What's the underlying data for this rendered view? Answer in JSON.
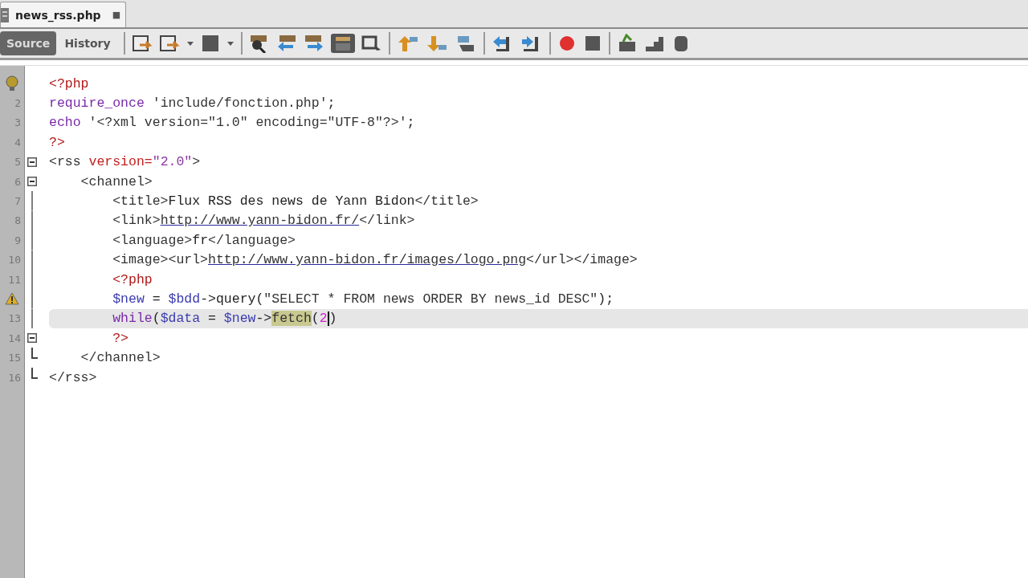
{
  "tab": {
    "title": "news_rss.php",
    "close": "■"
  },
  "toolbar": {
    "views": [
      {
        "label": "Source",
        "selected": true
      },
      {
        "label": "History",
        "selected": false
      }
    ]
  },
  "editor": {
    "lines": [
      {
        "hint": true,
        "warning": false,
        "fold_marker": false,
        "fold_end": false,
        "current": false,
        "tokens": [
          {
            "kind": "php",
            "text": "<?php"
          }
        ]
      },
      {
        "number": "2",
        "hint": false,
        "warning": false,
        "fold_marker": false,
        "fold_end": false,
        "current": false,
        "tokens": [
          {
            "kind": "keyword",
            "text": "require_once"
          },
          {
            "kind": "string",
            "text": " 'include/fonction.php'"
          },
          {
            "kind": "plain",
            "text": ";"
          }
        ]
      },
      {
        "number": "3",
        "hint": false,
        "warning": false,
        "fold_marker": false,
        "fold_end": false,
        "current": false,
        "tokens": [
          {
            "kind": "keyword",
            "text": "echo"
          },
          {
            "kind": "string",
            "text": " '<?xml version=\"1.0\" encoding=\"UTF-8\"?>'"
          },
          {
            "kind": "plain",
            "text": ";"
          }
        ]
      },
      {
        "number": "4",
        "hint": false,
        "warning": false,
        "fold_marker": false,
        "fold_end": false,
        "current": false,
        "tokens": [
          {
            "kind": "php",
            "text": "?>"
          }
        ]
      },
      {
        "number": "5",
        "hint": false,
        "warning": false,
        "fold_marker": true,
        "fold_end": false,
        "current": false,
        "tokens": [
          {
            "kind": "tag",
            "text": "<rss "
          },
          {
            "kind": "attr",
            "text": "version="
          },
          {
            "kind": "value",
            "text": "\"2.0\""
          },
          {
            "kind": "tag",
            "text": ">"
          }
        ],
        "children": [
          {
            "number": "6",
            "hint": false,
            "warning": false,
            "fold_marker": true,
            "fold_end": false,
            "current": false,
            "tokens": [
              {
                "kind": "tag",
                "text": "<channel>"
              }
            ],
            "children": [
              {
                "number": "7",
                "hint": false,
                "warning": false,
                "fold_marker": false,
                "fold_end": false,
                "current": false,
                "tokens": [
                  {
                    "kind": "tag",
                    "text": "<title>"
                  },
                  {
                    "kind": "plain",
                    "text": "Flux RSS des news de Yann Bidon"
                  },
                  {
                    "kind": "tag",
                    "text": "</title>"
                  }
                ]
              },
              {
                "number": "8",
                "hint": false,
                "warning": false,
                "fold_marker": false,
                "fold_end": false,
                "current": false,
                "tokens": [
                  {
                    "kind": "tag",
                    "text": "<link>"
                  },
                  {
                    "kind": "link",
                    "text": "http://www.yann-bidon.fr/"
                  },
                  {
                    "kind": "tag",
                    "text": "</link>"
                  }
                ]
              },
              {
                "number": "9",
                "hint": false,
                "warning": false,
                "fold_marker": false,
                "fold_end": false,
                "current": false,
                "tokens": [
                  {
                    "kind": "tag",
                    "text": "<language>"
                  },
                  {
                    "kind": "plain",
                    "text": "fr"
                  },
                  {
                    "kind": "tag",
                    "text": "</language>"
                  }
                ]
              },
              {
                "number": "10",
                "hint": false,
                "warning": false,
                "fold_marker": false,
                "fold_end": false,
                "current": false,
                "tokens": [
                  {
                    "kind": "tag",
                    "text": "<image><url>"
                  },
                  {
                    "kind": "link",
                    "text": "http://www.yann-bidon.fr/images/logo.png"
                  },
                  {
                    "kind": "tag",
                    "text": "</url></image>"
                  }
                ]
              },
              {
                "number": "11",
                "hint": false,
                "warning": false,
                "fold_marker": false,
                "fold_end": false,
                "current": false,
                "tokens": [
                  {
                    "kind": "php",
                    "text": "<?php"
                  }
                ]
              },
              {
                "hint": false,
                "warning": true,
                "fold_marker": false,
                "fold_end": false,
                "current": false,
                "tokens": [
                  {
                    "kind": "variable",
                    "text": "$new"
                  },
                  {
                    "kind": "plain",
                    "text": " = "
                  },
                  {
                    "kind": "variable",
                    "text": "$bdd"
                  },
                  {
                    "kind": "plain",
                    "text": "->query("
                  },
                  {
                    "kind": "string",
                    "text": "\"SELECT * FROM news ORDER BY news_id DESC\""
                  },
                  {
                    "kind": "plain",
                    "text": ");"
                  }
                ]
              },
              {
                "number": "13",
                "hint": false,
                "warning": false,
                "fold_marker": false,
                "fold_end": false,
                "current": true,
                "tokens": [
                  {
                    "kind": "keyword",
                    "text": "while"
                  },
                  {
                    "kind": "plain",
                    "text": "("
                  },
                  {
                    "kind": "variable",
                    "text": "$data"
                  },
                  {
                    "kind": "plain",
                    "text": " = "
                  },
                  {
                    "kind": "variable",
                    "text": "$new"
                  },
                  {
                    "kind": "plain",
                    "text": "->"
                  },
                  {
                    "kind": "occurrence",
                    "text": "fetch"
                  },
                  {
                    "kind": "plain",
                    "text": "("
                  },
                  {
                    "kind": "number",
                    "text": "2",
                    "caret": true
                  },
                  {
                    "kind": "plain",
                    "text": ")"
                  }
                ]
              },
              {
                "number": "14",
                "hint": false,
                "warning": false,
                "fold_marker": true,
                "fold_end": false,
                "current": false,
                "tokens": [
                  {
                    "kind": "php",
                    "text": "?>"
                  }
                ]
              }
            ]
          },
          {
            "number": "15",
            "hint": false,
            "warning": false,
            "fold_marker": false,
            "fold_end": true,
            "current": false,
            "tokens": [
              {
                "kind": "tag",
                "text": "</channel>"
              }
            ]
          }
        ]
      },
      {
        "number": "16",
        "hint": false,
        "warning": false,
        "fold_marker": false,
        "fold_end": true,
        "current": false,
        "tokens": [
          {
            "kind": "tag",
            "text": "</rss>"
          }
        ]
      }
    ]
  }
}
